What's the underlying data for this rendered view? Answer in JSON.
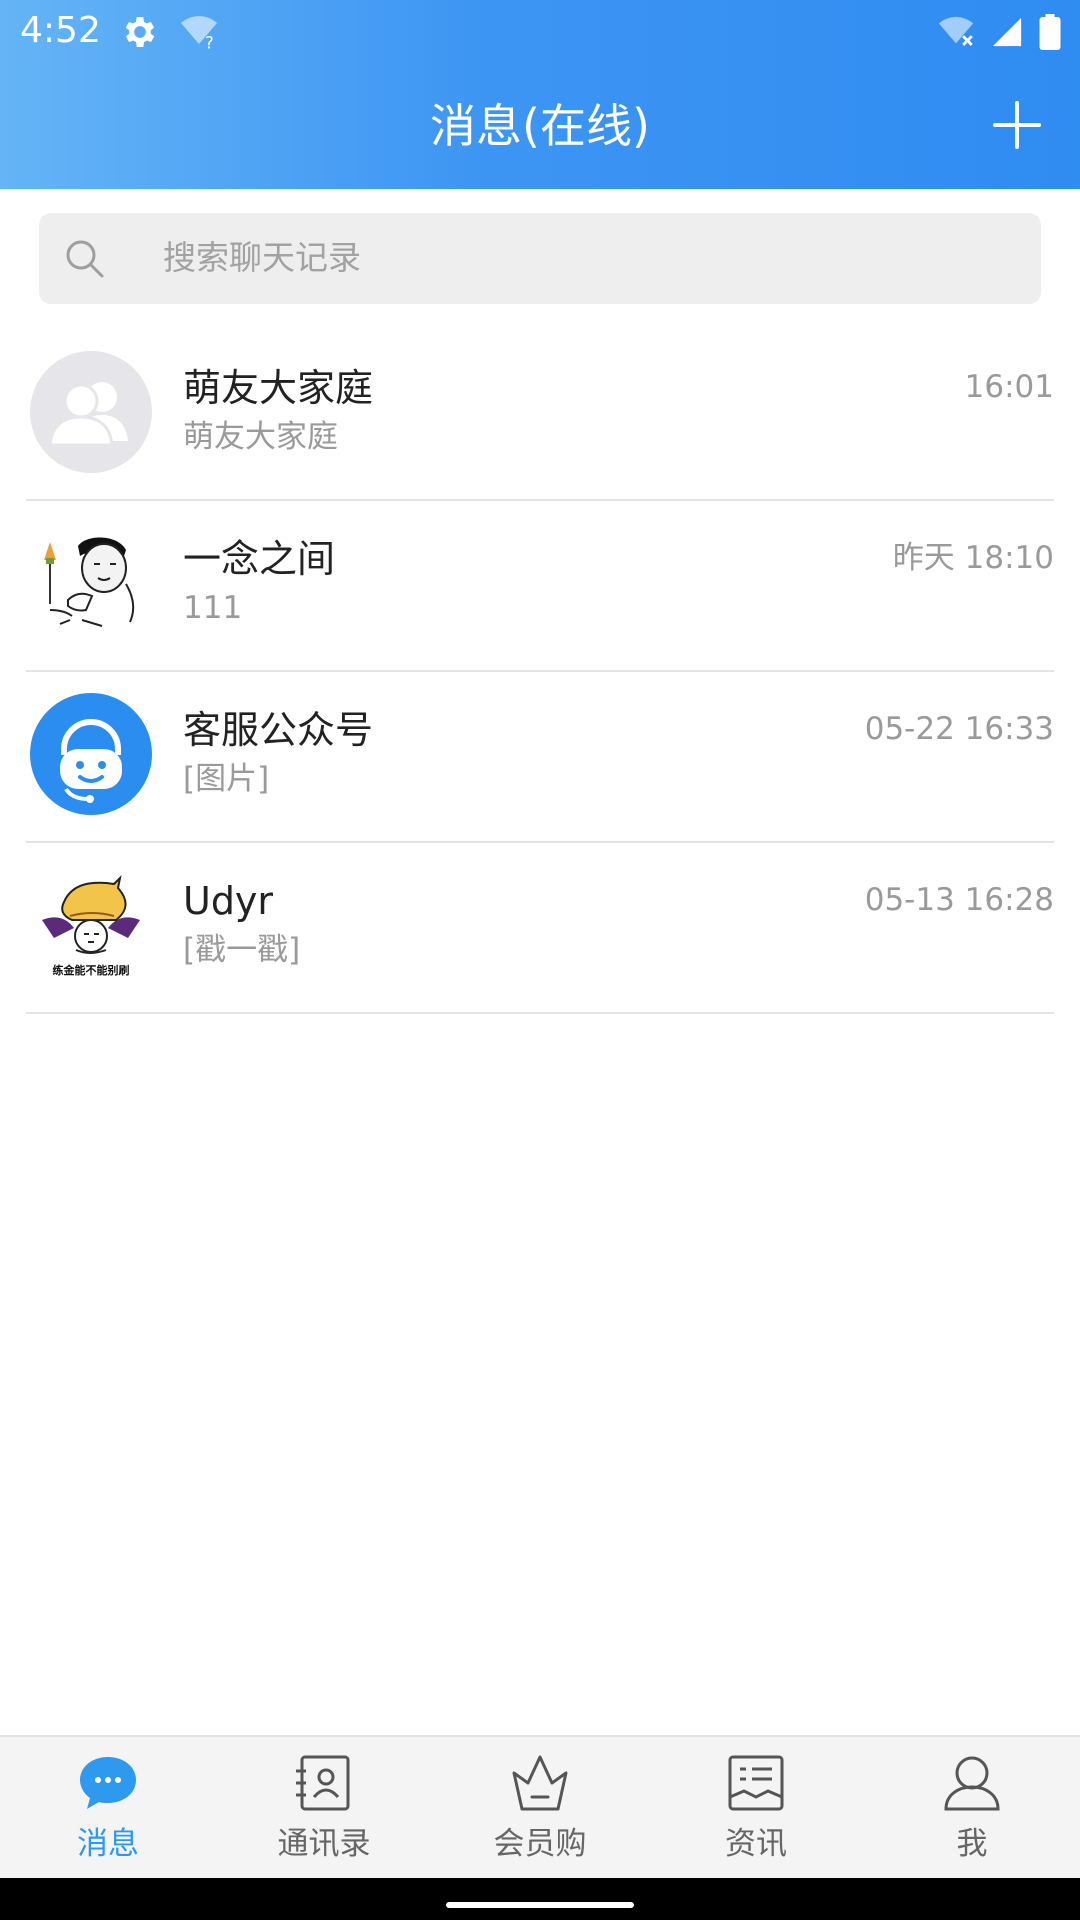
{
  "status_bar": {
    "time": "4:52",
    "icons": [
      "gear-icon",
      "wifi-question-icon",
      "wifi-x-icon",
      "signal-icon",
      "battery-icon"
    ]
  },
  "header": {
    "title": "消息(在线)",
    "add_icon": "plus-icon"
  },
  "search": {
    "placeholder": "搜索聊天记录"
  },
  "chats": [
    {
      "name": "萌友大家庭",
      "preview": "萌友大家庭",
      "time": "16:01",
      "avatar": "group-avatar"
    },
    {
      "name": "一念之间",
      "preview": "111",
      "time": "昨天 18:10",
      "avatar": "meme-face-avatar"
    },
    {
      "name": "客服公众号",
      "preview": "[图片]",
      "time": "05-22 16:33",
      "avatar": "customer-service-avatar"
    },
    {
      "name": "Udyr",
      "preview": "[戳一戳]",
      "time": "05-13 16:28",
      "avatar": "cartoon-avatar",
      "avatar_caption": "练金能不能别刷"
    }
  ],
  "bottom_nav": [
    {
      "label": "消息",
      "icon": "chat-bubble-icon",
      "active": true
    },
    {
      "label": "通讯录",
      "icon": "contacts-icon",
      "active": false
    },
    {
      "label": "会员购",
      "icon": "crown-icon",
      "active": false
    },
    {
      "label": "资讯",
      "icon": "news-icon",
      "active": false
    },
    {
      "label": "我",
      "icon": "person-icon",
      "active": false
    }
  ],
  "colors": {
    "header_start": "#64b4f6",
    "header_end": "#2f8cf1",
    "accent": "#2d9af0",
    "customer_service_avatar": "#2b8def"
  }
}
